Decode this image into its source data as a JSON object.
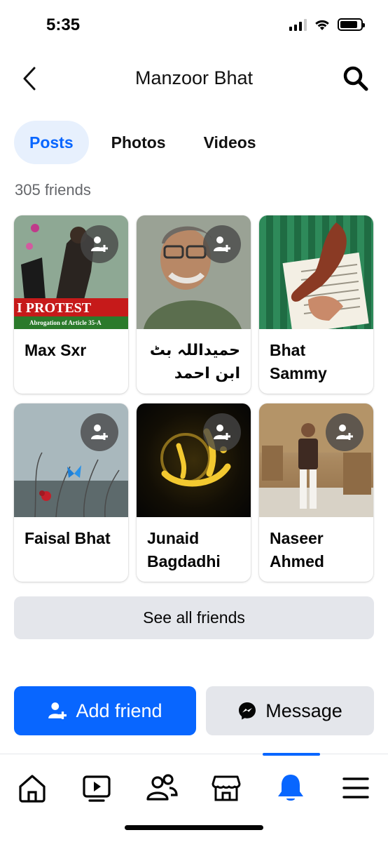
{
  "status_bar": {
    "time": "5:35",
    "battery_level": 0.85
  },
  "header": {
    "title": "Manzoor Bhat"
  },
  "tabs": [
    {
      "label": "Posts",
      "active": true
    },
    {
      "label": "Photos",
      "active": false
    },
    {
      "label": "Videos",
      "active": false
    }
  ],
  "friends": {
    "count_text": "305 friends",
    "items": [
      {
        "name": "Max Sxr",
        "photo_text": "I PROTEST",
        "photo_subtext": "Abrogation of Article 35-A"
      },
      {
        "name": "حمیداللہ بٹ ابن احمد"
      },
      {
        "name": "Bhat Sammy"
      },
      {
        "name": "Faisal Bhat"
      },
      {
        "name": "Junaid Bagdadhi"
      },
      {
        "name": "Naseer Ahmed"
      }
    ],
    "see_all_label": "See all friends"
  },
  "actions": {
    "add_friend_label": "Add friend",
    "message_label": "Message"
  },
  "colors": {
    "accent": "#0866ff",
    "active_tab_bg": "#e7f0fd",
    "button_gray": "#e4e6eb",
    "secondary_text": "#65676b"
  },
  "bottom_nav": [
    {
      "icon": "home-icon",
      "active": false
    },
    {
      "icon": "video-icon",
      "active": false
    },
    {
      "icon": "friends-icon",
      "active": false
    },
    {
      "icon": "marketplace-icon",
      "active": false
    },
    {
      "icon": "notifications-icon",
      "active": true
    },
    {
      "icon": "menu-icon",
      "active": false
    }
  ]
}
